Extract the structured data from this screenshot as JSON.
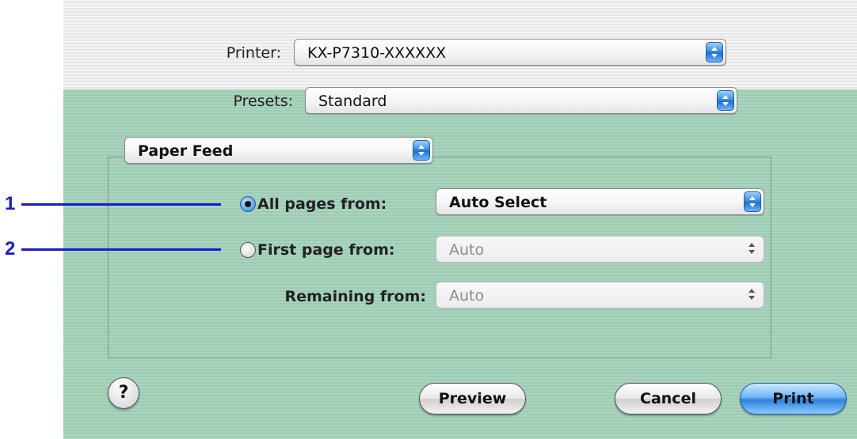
{
  "printer": {
    "label": "Printer:",
    "value": "KX-P7310-XXXXXX"
  },
  "presets": {
    "label": "Presets:",
    "value": "Standard"
  },
  "panel_select": {
    "value": "Paper Feed"
  },
  "all_pages": {
    "label": "All pages from:",
    "value": "Auto Select",
    "selected": true
  },
  "first_page": {
    "label": "First page from:",
    "value": "Auto",
    "selected": false
  },
  "remaining": {
    "label": "Remaining from:",
    "value": "Auto"
  },
  "buttons": {
    "help": "?",
    "preview": "Preview",
    "cancel": "Cancel",
    "print": "Print"
  },
  "callouts": {
    "one": "1",
    "two": "2"
  },
  "colors": {
    "dialog_green": "#a9d4be",
    "accent_blue": "#2d82db",
    "callout_blue": "#1a1acc"
  }
}
